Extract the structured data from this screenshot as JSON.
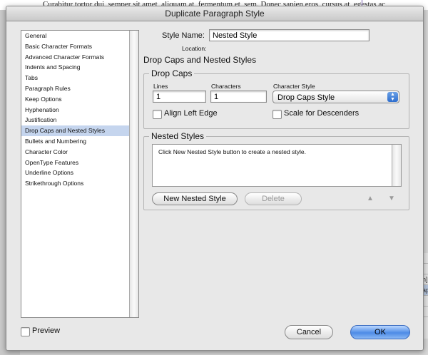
{
  "background": {
    "doc_text": "Curabitur tortor dui, semper sit amet, aliquam at, fermentum et, sem. Donec sapien eros, cursus at, egestas ac",
    "panel_rows": [
      "",
      "",
      "raph]",
      "agraph",
      "",
      ""
    ]
  },
  "dialog": {
    "title": "Duplicate Paragraph Style"
  },
  "categories": [
    "General",
    "Basic Character Formats",
    "Advanced Character Formats",
    "Indents and Spacing",
    "Tabs",
    "Paragraph Rules",
    "Keep Options",
    "Hyphenation",
    "Justification",
    "Drop Caps and Nested Styles",
    "Bullets and Numbering",
    "Character Color",
    "OpenType Features",
    "Underline Options",
    "Strikethrough Options"
  ],
  "selected_category": "Drop Caps and Nested Styles",
  "style_name": {
    "label": "Style Name:",
    "value": "Nested Style",
    "location_label": "Location:"
  },
  "section_title": "Drop Caps and Nested Styles",
  "drop_caps": {
    "title": "Drop Caps",
    "lines_label": "Lines",
    "lines_value": "1",
    "characters_label": "Characters",
    "characters_value": "1",
    "char_style_label": "Character Style",
    "char_style_value": "Drop Caps Style",
    "align_left_edge_label": "Align Left Edge",
    "align_left_edge_checked": false,
    "scale_descenders_label": "Scale for Descenders",
    "scale_descenders_checked": false
  },
  "nested_styles": {
    "title": "Nested Styles",
    "empty_message": "Click New Nested Style button to create a nested style.",
    "new_button": "New Nested Style",
    "delete_button": "Delete"
  },
  "footer": {
    "preview_label": "Preview",
    "preview_checked": false,
    "cancel": "Cancel",
    "ok": "OK"
  }
}
